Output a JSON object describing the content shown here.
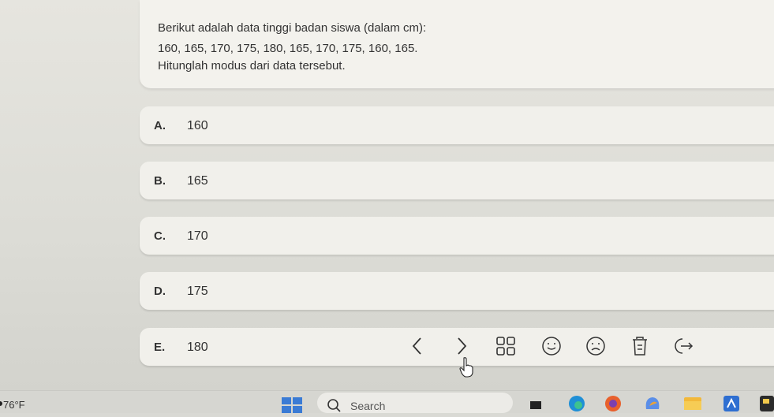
{
  "question": {
    "line1": "Berikut adalah data tinggi badan siswa (dalam cm):",
    "line2": "160, 165, 170, 175, 180, 165, 170, 175, 160, 165.",
    "line3": "Hitunglah modus dari data tersebut."
  },
  "options": [
    {
      "letter": "A.",
      "text": "160"
    },
    {
      "letter": "B.",
      "text": "165"
    },
    {
      "letter": "C.",
      "text": "170"
    },
    {
      "letter": "D.",
      "text": "175"
    },
    {
      "letter": "E.",
      "text": "180"
    }
  ],
  "toolbar": {
    "icons": [
      "chevron-left-icon",
      "chevron-right-icon",
      "grid-icon",
      "smile-icon",
      "frown-icon",
      "trash-icon",
      "exit-icon"
    ]
  },
  "taskbar": {
    "weather": "76°F",
    "search_label": "Search"
  },
  "colors": {
    "accent_blue": "#3a7bd5",
    "card_bg": "#f1f0eb"
  }
}
